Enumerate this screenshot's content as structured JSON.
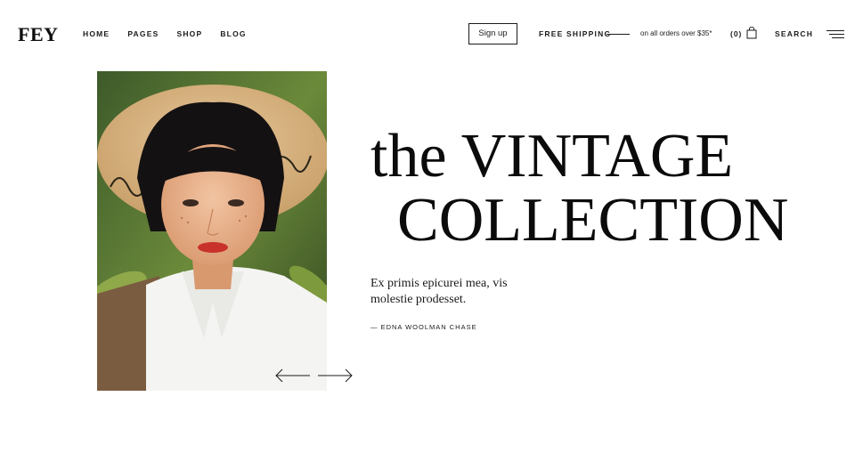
{
  "header": {
    "logo": "FEY",
    "nav": [
      {
        "label": "HOME"
      },
      {
        "label": "PAGES"
      },
      {
        "label": "SHOP"
      },
      {
        "label": "BLOG"
      }
    ],
    "signup_label": "Sign up",
    "shipping_label": "FREE SHIPPING",
    "shipping_note": "on all orders over $35*",
    "cart_count": "(0)",
    "search_label": "SEARCH"
  },
  "hero": {
    "headline_line1": "the VINTAGE",
    "headline_line2": "COLLECTION",
    "quote": "Ex primis epicurei mea, vis molestie prodesset.",
    "attribution": "— EDNA WOOLMAN CHASE"
  },
  "icons": {
    "bag": "shopping-bag-icon",
    "menu": "hamburger-menu-icon",
    "prev": "arrow-left-icon",
    "next": "arrow-right-icon"
  },
  "colors": {
    "text": "#111111",
    "background": "#ffffff"
  }
}
